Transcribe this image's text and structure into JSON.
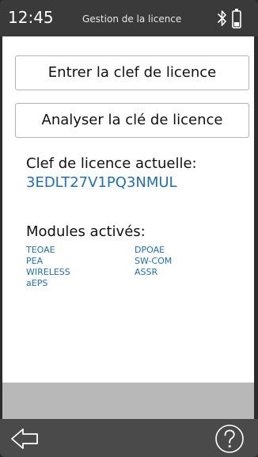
{
  "statusbar": {
    "time": "12:45",
    "title": "Gestion de la licence",
    "icons": [
      "bluetooth-icon",
      "battery-icon"
    ]
  },
  "actions": {
    "enter_key_label": "Entrer la clef de licence",
    "scan_key_label": "Analyser la clé de licence"
  },
  "license": {
    "current_label": "Clef de licence actuelle:",
    "key": "3EDLT27V1PQ3NMUL"
  },
  "modules": {
    "label": "Modules activés:",
    "left": [
      "TEOAE",
      "PEA",
      "WIRELESS",
      "aEPS"
    ],
    "right": [
      "DPOAE",
      "SW-COM",
      "ASSR"
    ]
  },
  "navbar": {
    "icons": [
      "back-arrow-icon",
      "help-icon"
    ]
  },
  "colors": {
    "link_blue": "#1f6fb5",
    "statusbar_bg": "#3a3a3a",
    "navbar_bg": "#4a4a4a",
    "gray_bar": "#b8b8b8"
  }
}
